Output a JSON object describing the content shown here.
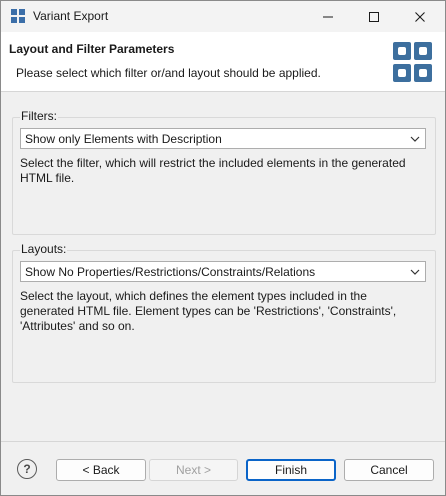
{
  "window": {
    "title": "Variant Export",
    "controls": {
      "minimize": "minimize-icon",
      "maximize": "maximize-icon",
      "close": "close-icon"
    }
  },
  "banner": {
    "title": "Layout and Filter Parameters",
    "subtitle": "Please select which filter or/and layout should be applied.",
    "icon": "wizard-grid-icon"
  },
  "filters": {
    "legend": "Filters:",
    "selected": "Show only Elements with Description",
    "description": "Select the filter, which will restrict the included elements in the generated HTML file."
  },
  "layouts": {
    "legend": "Layouts:",
    "selected": "Show No Properties/Restrictions/Constraints/Relations",
    "description": "Select the layout, which defines the element types included in the generated HTML file. Element types can be 'Restrictions', 'Constraints', 'Attributes' and so on."
  },
  "footer": {
    "help": "?",
    "back": "< Back",
    "next": "Next >",
    "finish": "Finish",
    "cancel": "Cancel"
  },
  "colors": {
    "accent": "#0a64c8",
    "icon_blue": "#3d6f9e",
    "banner_bg": "#ffffff",
    "dialog_bg": "#f0f0f0"
  }
}
